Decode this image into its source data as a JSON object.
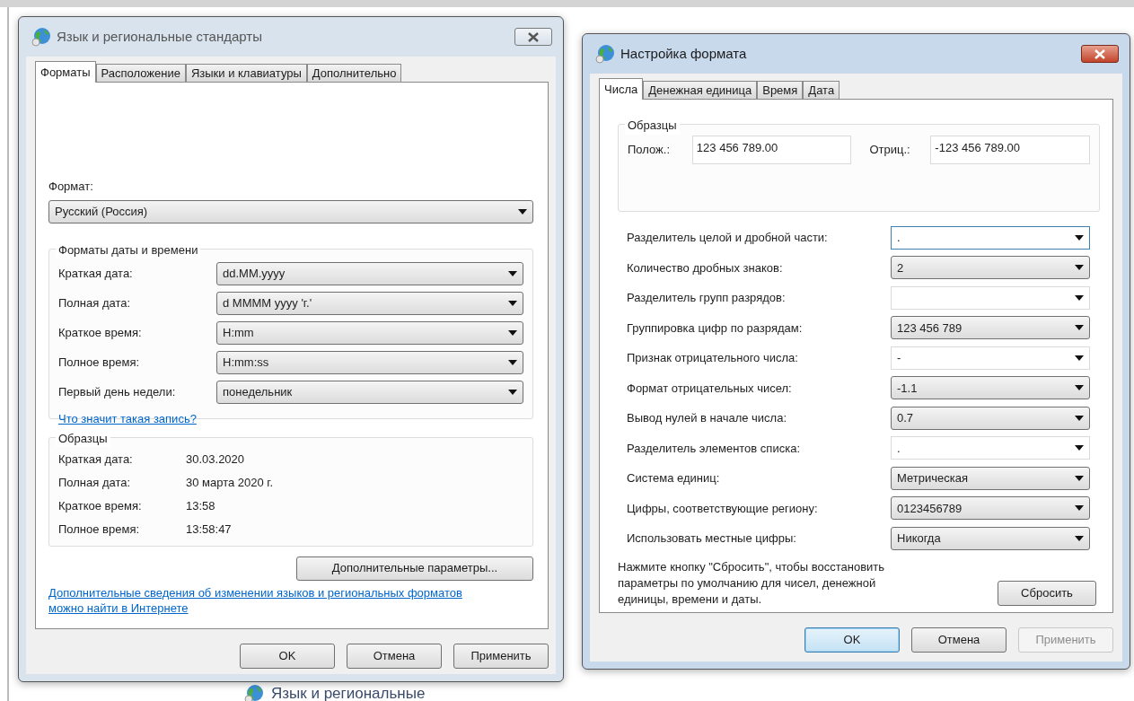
{
  "background": {
    "caption": "Язык и региональные"
  },
  "region_dialog": {
    "title": "Язык и региональные стандарты",
    "active": false,
    "tabs": [
      {
        "label": "Форматы",
        "selected": true
      },
      {
        "label": "Расположение",
        "selected": false
      },
      {
        "label": "Языки и клавиатуры",
        "selected": false
      },
      {
        "label": "Дополнительно",
        "selected": false
      }
    ],
    "format": {
      "label": "Формат:",
      "value": "Русский (Россия)"
    },
    "datetime_group": {
      "title": "Форматы даты и времени",
      "rows": [
        {
          "label": "Краткая дата:",
          "value": "dd.MM.yyyy"
        },
        {
          "label": "Полная дата:",
          "value": "d MMMM yyyy 'г.'"
        },
        {
          "label": "Краткое время:",
          "value": "H:mm"
        },
        {
          "label": "Полное время:",
          "value": "H:mm:ss"
        },
        {
          "label": "Первый день недели:",
          "value": "понедельник"
        }
      ],
      "link": "Что значит такая запись?"
    },
    "samples": {
      "title": "Образцы",
      "rows": [
        {
          "label": "Краткая дата:",
          "value": "30.03.2020"
        },
        {
          "label": "Полная дата:",
          "value": "30 марта 2020 г."
        },
        {
          "label": "Краткое время:",
          "value": "13:58"
        },
        {
          "label": "Полное время:",
          "value": "13:58:47"
        }
      ]
    },
    "advanced_button": "Дополнительные параметры...",
    "info_link": "Дополнительные сведения об изменении языков и региональных форматов можно найти в Интернете",
    "buttons": [
      {
        "label": "OK",
        "default": false,
        "disabled": false
      },
      {
        "label": "Отмена",
        "default": false,
        "disabled": false
      },
      {
        "label": "Применить",
        "default": false,
        "disabled": false
      }
    ]
  },
  "format_dialog": {
    "title": "Настройка формата",
    "active": true,
    "tabs": [
      {
        "label": "Числа",
        "selected": true
      },
      {
        "label": "Денежная единица",
        "selected": false
      },
      {
        "label": "Время",
        "selected": false
      },
      {
        "label": "Дата",
        "selected": false
      }
    ],
    "samples": {
      "title": "Образцы",
      "positive_label": "Полож.:",
      "positive": "123 456 789.00",
      "negative_label": "Отриц.:",
      "negative": "-123 456 789.00"
    },
    "settings": [
      {
        "label": "Разделитель целой и дробной части:",
        "value": ".",
        "kind": "edit",
        "focused": true
      },
      {
        "label": "Количество дробных знаков:",
        "value": "2",
        "kind": "list",
        "focused": false
      },
      {
        "label": "Разделитель групп разрядов:",
        "kind": "edit",
        "focused": false
      },
      {
        "label": "Группировка цифр по разрядам:",
        "value": "123 456 789",
        "kind": "list",
        "focused": false
      },
      {
        "label": "Признак отрицательного числа:",
        "value": "-",
        "kind": "edit",
        "focused": false
      },
      {
        "label": "Формат отрицательных чисел:",
        "value": "-1.1",
        "kind": "list",
        "focused": false
      },
      {
        "label": "Вывод нулей в начале числа:",
        "value": "0.7",
        "kind": "list",
        "focused": false
      },
      {
        "label": "Разделитель элементов списка:",
        "value": ".",
        "kind": "edit",
        "focused": false
      },
      {
        "label": "Система единиц:",
        "value": "Метрическая",
        "kind": "list",
        "focused": false
      },
      {
        "label": "Цифры, соответствующие региону:",
        "value": "0123456789",
        "kind": "list",
        "focused": false
      },
      {
        "label": "Использовать местные цифры:",
        "value": "Никогда",
        "kind": "list",
        "focused": false
      }
    ],
    "reset_note": "Нажмите кнопку \"Сбросить\", чтобы восстановить параметры по умолчанию для чисел, денежной единицы, времени и даты.",
    "reset_button": "Сбросить",
    "buttons": [
      {
        "label": "OK",
        "default": true,
        "disabled": false
      },
      {
        "label": "Отмена",
        "default": false,
        "disabled": false
      },
      {
        "label": "Применить",
        "default": false,
        "disabled": true
      }
    ]
  }
}
